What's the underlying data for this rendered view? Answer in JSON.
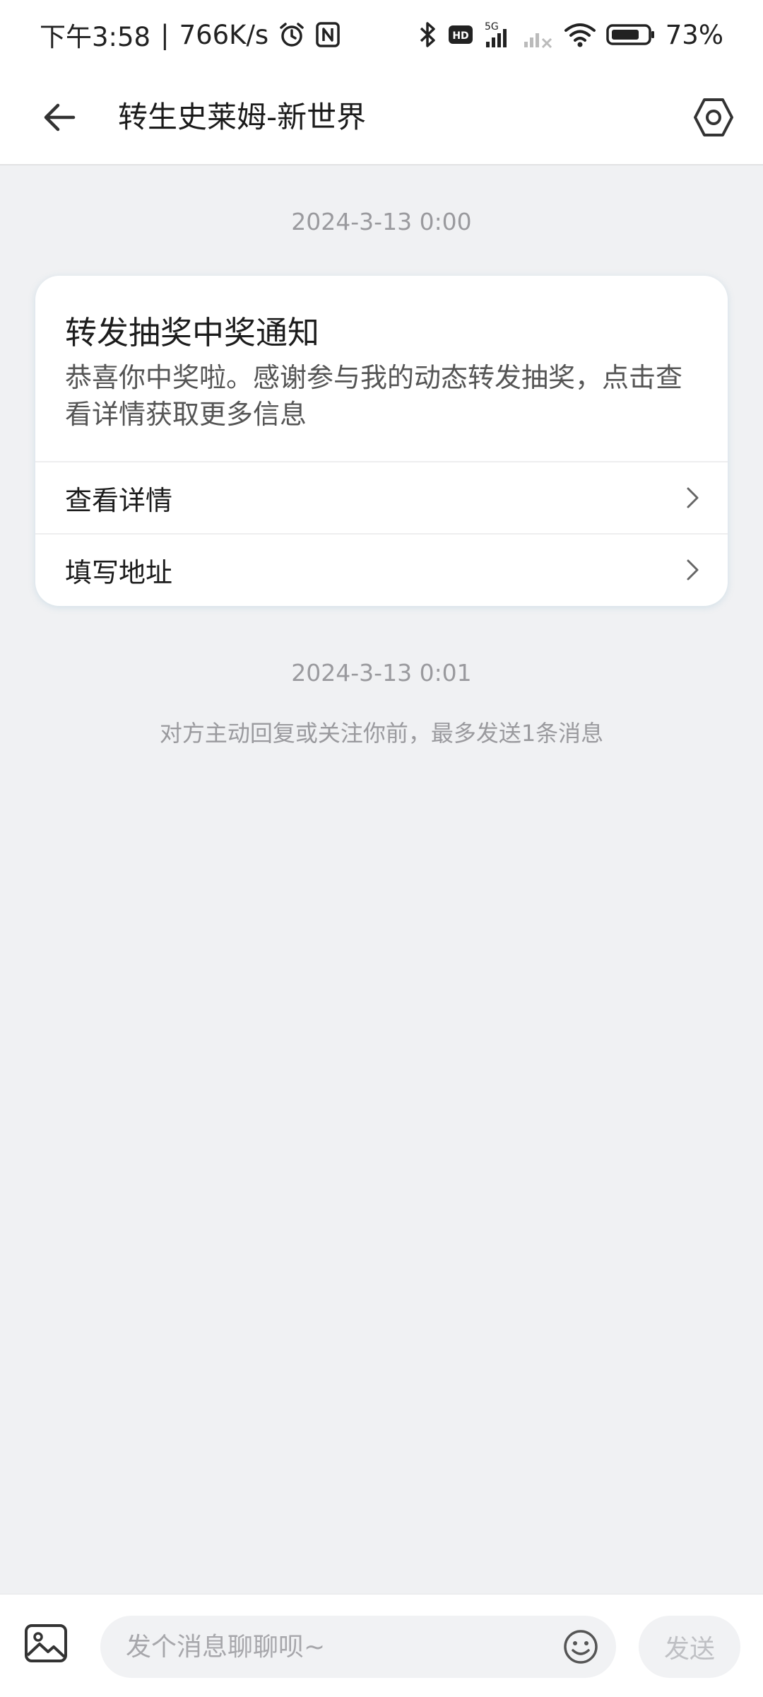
{
  "status_bar": {
    "time": "下午3:58",
    "net_speed": "766K/s",
    "network": "5G",
    "battery": "73%",
    "icons": [
      "alarm-icon",
      "nfc-icon",
      "bluetooth-icon",
      "hd-icon",
      "signal-icon",
      "wifi-icon",
      "battery-icon"
    ]
  },
  "header": {
    "back_icon": "arrow-left-icon",
    "title": "转生史莱姆-新世界",
    "settings_icon": "hexagon-settings-icon"
  },
  "messages": {
    "timestamp_1": "2024-3-13 0:00",
    "card": {
      "title": "转发抽奖中奖通知",
      "body": "恭喜你中奖啦。感谢参与我的动态转发抽奖，点击查看详情获取更多信息",
      "actions": [
        {
          "label": "查看详情"
        },
        {
          "label": "填写地址"
        }
      ]
    },
    "timestamp_2": "2024-3-13 0:01",
    "notice": "对方主动回复或关注你前，最多发送1条消息"
  },
  "composer": {
    "image_icon": "image-icon",
    "placeholder": "发个消息聊聊呗~",
    "emoji_icon": "emoji-icon",
    "send_label": "发送"
  },
  "colors": {
    "background": "#f0f1f3",
    "card": "#ffffff",
    "muted_text": "#9a9a9e",
    "disabled_send": "#bfc0c4"
  }
}
